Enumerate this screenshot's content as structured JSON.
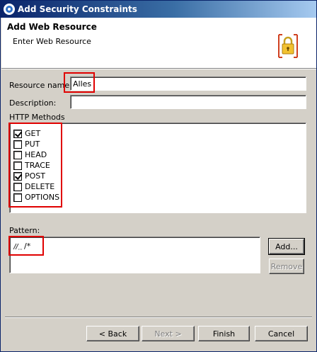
{
  "window": {
    "title": "Add Security Constraints"
  },
  "banner": {
    "title": "Add Web Resource",
    "subtitle": "Enter Web Resource",
    "icon": "lock-icon"
  },
  "form": {
    "resource_name_label": "Resource name",
    "resource_name_value": "Alles",
    "description_label": "Description:",
    "description_value": "",
    "http_methods_label": "HTTP Methods",
    "methods": [
      {
        "label": "GET",
        "checked": true
      },
      {
        "label": "PUT",
        "checked": false
      },
      {
        "label": "HEAD",
        "checked": false
      },
      {
        "label": "TRACE",
        "checked": false
      },
      {
        "label": "POST",
        "checked": true
      },
      {
        "label": "DELETE",
        "checked": false
      },
      {
        "label": "OPTIONS",
        "checked": false
      }
    ],
    "pattern_label": "Pattern:",
    "pattern_value": "/*",
    "add_button": "Add...",
    "remove_button": "Remove"
  },
  "footer": {
    "back_button": "< Back",
    "next_button": "Next >",
    "finish_button": "Finish",
    "cancel_button": "Cancel"
  },
  "colors": {
    "highlight": "#e00000",
    "title_gradient_start": "#0a246a",
    "title_gradient_end": "#a6caf0"
  }
}
